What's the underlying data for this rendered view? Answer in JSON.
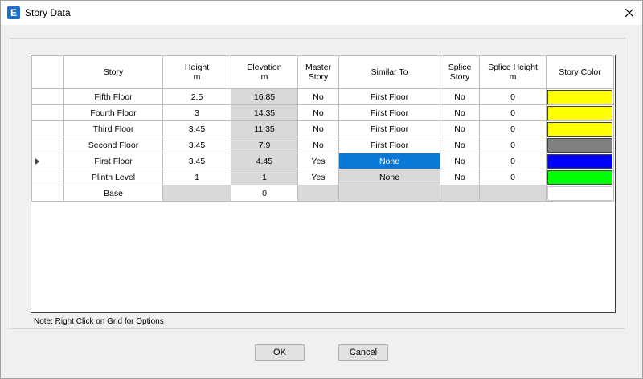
{
  "window": {
    "title": "Story Data",
    "app_icon_letter": "E"
  },
  "grid": {
    "headers": {
      "story": "Story",
      "height": "Height",
      "height_unit": "m",
      "elevation": "Elevation",
      "elevation_unit": "m",
      "master_story_1": "Master",
      "master_story_2": "Story",
      "similar_to": "Similar To",
      "splice_story_1": "Splice",
      "splice_story_2": "Story",
      "splice_height": "Splice Height",
      "splice_height_unit": "m",
      "story_color": "Story Color"
    },
    "rows": [
      {
        "story": "Fifth Floor",
        "height": "2.5",
        "elevation": "16.85",
        "master": "No",
        "similar": "First Floor",
        "splice": "No",
        "splice_height": "0",
        "color": "#ffff00"
      },
      {
        "story": "Fourth Floor",
        "height": "3",
        "elevation": "14.35",
        "master": "No",
        "similar": "First Floor",
        "splice": "No",
        "splice_height": "0",
        "color": "#ffff00"
      },
      {
        "story": "Third Floor",
        "height": "3.45",
        "elevation": "11.35",
        "master": "No",
        "similar": "First Floor",
        "splice": "No",
        "splice_height": "0",
        "color": "#ffff00"
      },
      {
        "story": "Second Floor",
        "height": "3.45",
        "elevation": "7.9",
        "master": "No",
        "similar": "First Floor",
        "splice": "No",
        "splice_height": "0",
        "color": "#808080"
      },
      {
        "story": "First Floor",
        "height": "3.45",
        "elevation": "4.45",
        "master": "Yes",
        "similar": "None",
        "splice": "No",
        "splice_height": "0",
        "color": "#0000ff"
      },
      {
        "story": "Plinth Level",
        "height": "1",
        "elevation": "1",
        "master": "Yes",
        "similar": "None",
        "splice": "No",
        "splice_height": "0",
        "color": "#00ff00"
      },
      {
        "story": "Base",
        "height": "",
        "elevation": "0",
        "master": "",
        "similar": "",
        "splice": "",
        "splice_height": "",
        "color": "#ffffff"
      }
    ],
    "current_row": "First Floor"
  },
  "note": "Note:  Right Click on Grid for Options",
  "buttons": {
    "ok": "OK",
    "cancel": "Cancel"
  },
  "colors": {
    "selection": "#0a78d7",
    "readonly_cell": "#d9d9d9",
    "app_icon": "#1f6fc7"
  }
}
